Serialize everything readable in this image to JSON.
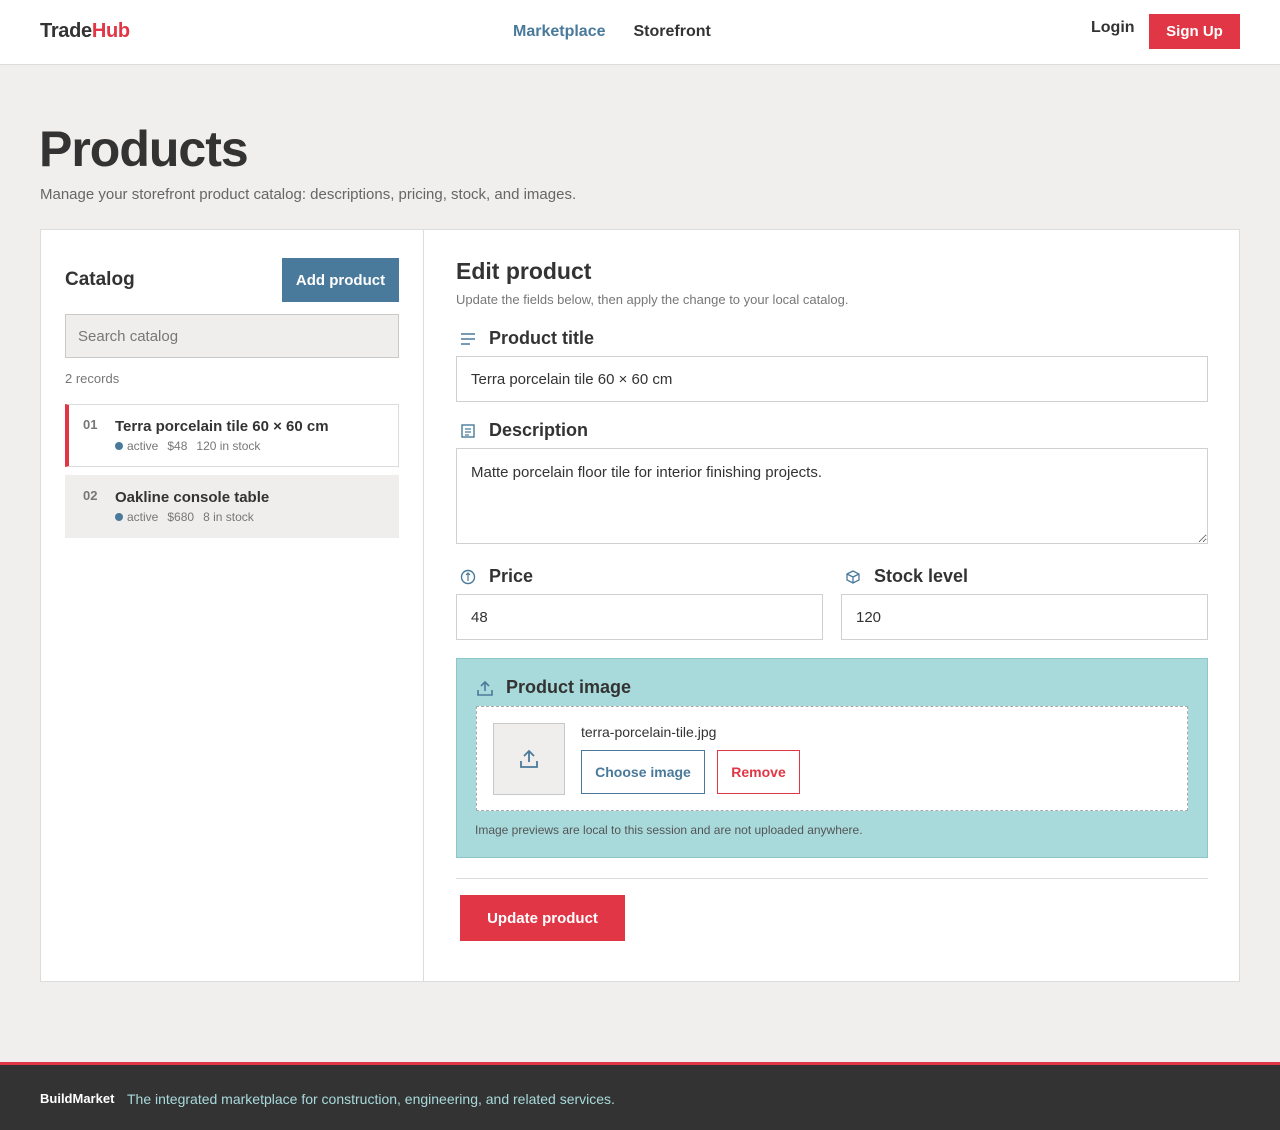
{
  "header": {
    "logo_part1": "Trade",
    "logo_part2": "Hub",
    "nav": [
      "Marketplace",
      "Storefront"
    ],
    "login": "Login",
    "signup": "Sign Up"
  },
  "page": {
    "title": "Products",
    "subtitle": "Manage your storefront product catalog: descriptions, pricing, stock, and images."
  },
  "catalog": {
    "heading": "Catalog",
    "add_label": "Add product",
    "search_placeholder": "Search catalog",
    "records": "2 records",
    "items": [
      {
        "num": "01",
        "name": "Terra porcelain tile 60 × 60 cm",
        "status": "active",
        "price": "$48",
        "stock": "120 in stock"
      },
      {
        "num": "02",
        "name": "Oakline console table",
        "status": "active",
        "price": "$680",
        "stock": "8 in stock"
      }
    ]
  },
  "edit": {
    "heading": "Edit product",
    "subtitle": "Update the fields below, then apply the change to your local catalog.",
    "title_label": "Product title",
    "title_value": "Terra porcelain tile 60 × 60 cm",
    "desc_label": "Description",
    "desc_value": "Matte porcelain floor tile for interior finishing projects.",
    "price_label": "Price",
    "price_value": "48",
    "stock_label": "Stock level",
    "stock_value": "120",
    "image_label": "Product image",
    "image_filename": "terra-porcelain-tile.jpg",
    "choose_label": "Choose image",
    "remove_label": "Remove",
    "image_note": "Image previews are local to this session and are not uploaded anywhere.",
    "update_label": "Update product"
  },
  "footer": {
    "brand": "BuildMarket",
    "tagline": "The integrated marketplace for construction, engineering, and related services."
  },
  "colors": {
    "accent_red": "#e03645",
    "accent_blue": "#4a7a9b",
    "teal": "#a8dadc",
    "footer_bg": "#333333"
  }
}
